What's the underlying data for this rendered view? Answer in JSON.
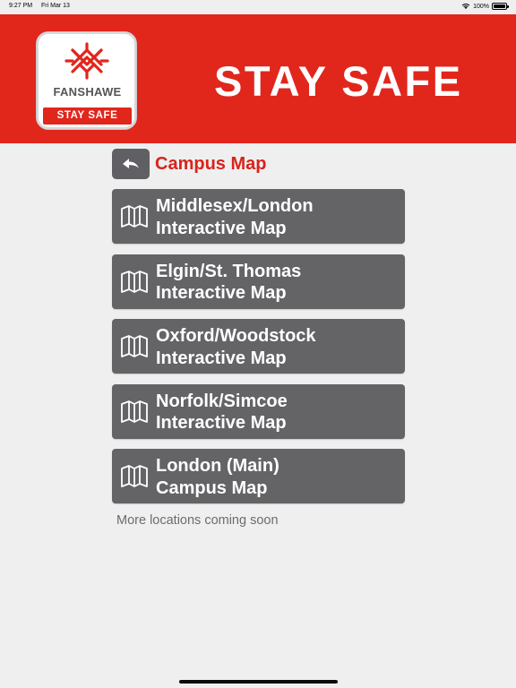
{
  "status_bar": {
    "time": "9:27 PM",
    "date": "Fri Mar 13",
    "battery": "100%"
  },
  "header": {
    "logo_word": "FANSHAWE",
    "logo_band": "STAY SAFE",
    "title": "STAY SAFE",
    "brand_color": "#e1261c"
  },
  "page": {
    "title": "Campus Map",
    "back_icon": "back-arrow-icon"
  },
  "maps": [
    {
      "line1": "Middlesex/London",
      "line2": "Interactive Map",
      "icon": "map-icon"
    },
    {
      "line1": "Elgin/St. Thomas",
      "line2": "Interactive Map",
      "icon": "map-icon"
    },
    {
      "line1": "Oxford/Woodstock",
      "line2": "Interactive Map",
      "icon": "map-icon"
    },
    {
      "line1": "Norfolk/Simcoe",
      "line2": "Interactive Map",
      "icon": "map-icon"
    },
    {
      "line1": "London (Main)",
      "line2": "Campus Map",
      "icon": "map-icon"
    }
  ],
  "footnote": "More locations coming soon"
}
